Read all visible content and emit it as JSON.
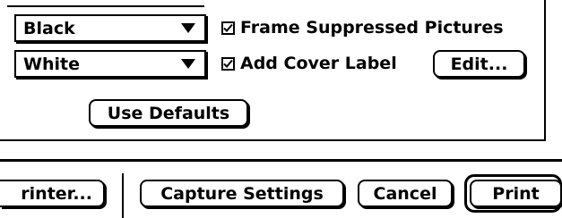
{
  "options_panel": {
    "frame_color_popup": {
      "selected": "Black"
    },
    "background_color_popup": {
      "selected": "White"
    },
    "frame_suppressed_pictures": {
      "label": "Frame Suppressed Pictures",
      "checked": true
    },
    "add_cover_label": {
      "label": "Add Cover Label",
      "checked": true
    },
    "edit_button_label": "Edit...",
    "use_defaults_button_label": "Use Defaults"
  },
  "footer": {
    "printer_button_label": "rinter...",
    "capture_settings_button_label": "Capture Settings",
    "cancel_button_label": "Cancel",
    "print_button_label": "Print"
  }
}
